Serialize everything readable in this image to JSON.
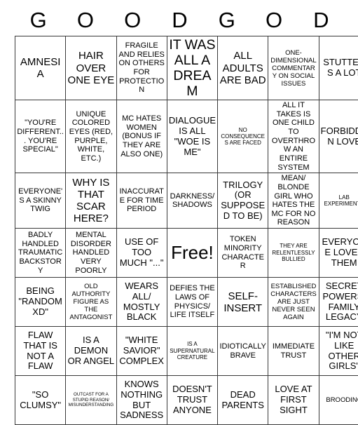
{
  "card": {
    "header_letters": [
      "G",
      "O",
      "O",
      "D",
      "G",
      "O",
      "D"
    ],
    "free_space_label": "Free!",
    "colors": {
      "border": "#3a3a3a",
      "background": "#ffffff",
      "text": "#000000"
    },
    "rows": [
      [
        {
          "text": "AMNESIA",
          "size": "xl"
        },
        {
          "text": "HAIR OVER ONE EYE",
          "size": "xl"
        },
        {
          "text": "FRAGILE AND RELIES ON OTHERS FOR PROTECTION",
          "size": "md"
        },
        {
          "text": "IT WAS ALL A DREAM",
          "size": "xxl"
        },
        {
          "text": "ALL ADULTS ARE BAD",
          "size": "xl"
        },
        {
          "text": "ONE-DIMENSIONAL COMMENTARY ON SOCIAL ISSUES",
          "size": "sm"
        },
        {
          "text": "STUTTERS A LOT",
          "size": "lg"
        }
      ],
      [
        {
          "text": "\"YOU'RE DIFFERENT... YOU'RE SPECIAL\"",
          "size": "md"
        },
        {
          "text": "UNIQUE COLORED EYES (RED, PURPLE, WHITE, ETC.)",
          "size": "md"
        },
        {
          "text": "MC HATES WOMEN (BONUS IF THEY ARE ALSO ONE)",
          "size": "md"
        },
        {
          "text": "DIALOGUE IS ALL \"WOE IS ME\"",
          "size": "lg"
        },
        {
          "text": "NO CONSEQUENCES ARE FACED",
          "size": "xs"
        },
        {
          "text": "ALL IT TAKES IS ONE CHILD TO OVERTHROW AN ENTIRE SYSTEM",
          "size": "md"
        },
        {
          "text": "FORBIDDEN LOVE",
          "size": "lg"
        }
      ],
      [
        {
          "text": "EVERYONE'S A SKINNY TWIG",
          "size": "md"
        },
        {
          "text": "WHY IS THAT SCAR HERE?",
          "size": "xl"
        },
        {
          "text": "INACCURATE FOR TIME PERIOD",
          "size": "md"
        },
        {
          "text": "DARKNESS/ SHADOWS",
          "size": "md"
        },
        {
          "text": "TRILOGY (OR SUPPOSED TO BE)",
          "size": "lg"
        },
        {
          "text": "MEAN/ BLONDE GIRL WHO HATES THE MC FOR NO REASON",
          "size": "md"
        },
        {
          "text": "LAB EXPERIMENTS",
          "size": "xs"
        }
      ],
      [
        {
          "text": "BADLY HANDLED TRAUMATIC BACKSTORY",
          "size": "md"
        },
        {
          "text": "MENTAL DISORDER HANDLED VERY POORLY",
          "size": "md"
        },
        {
          "text": "USE OF TOO MUCH \"...\"",
          "size": "lg"
        },
        {
          "text": "Free!",
          "size": "free"
        },
        {
          "text": "TOKEN MINORITY CHARACTER",
          "size": "md"
        },
        {
          "text": "THEY ARE RELENTLESSLY BULLIED",
          "size": "xs"
        },
        {
          "text": "EVERYONE LOVES THEM",
          "size": "lg"
        }
      ],
      [
        {
          "text": "BEING \"RANDOM XD\"",
          "size": "lg"
        },
        {
          "text": "OLD AUTHORITY FIGURE AS THE ANTAGONIST",
          "size": "sm"
        },
        {
          "text": "WEARS ALL/ MOSTLY BLACK",
          "size": "lg"
        },
        {
          "text": "DEFIES THE LAWS OF PHYSICS/ LIFE ITSELF",
          "size": "md"
        },
        {
          "text": "SELF-INSERT",
          "size": "xl"
        },
        {
          "text": "ESTABLISHED CHARACTERS ARE JUST NEVER SEEN AGAIN",
          "size": "sm"
        },
        {
          "text": "SECRET POWERS/ FAMILY LEGACY",
          "size": "lg"
        }
      ],
      [
        {
          "text": "FLAW THAT IS NOT A FLAW",
          "size": "lg"
        },
        {
          "text": "IS A DEMON OR ANGEL",
          "size": "lg"
        },
        {
          "text": "\"WHITE SAVIOR\" COMPLEX",
          "size": "lg"
        },
        {
          "text": "IS A SUPERNATURAL CREATURE",
          "size": "xs"
        },
        {
          "text": "IDIOTICALLY BRAVE",
          "size": "md"
        },
        {
          "text": "IMMEDIATE TRUST",
          "size": "md"
        },
        {
          "text": "\"I'M NOT LIKE OTHER GIRLS\"",
          "size": "lg"
        }
      ],
      [
        {
          "text": "\"SO CLUMSY\"",
          "size": "lg"
        },
        {
          "text": "OUTCAST FOR A STUPID REASON/ MISUNDERSTANDING",
          "size": "xxs"
        },
        {
          "text": "KNOWS NOTHING BUT SADNESS",
          "size": "lg"
        },
        {
          "text": "DOESN'T TRUST ANYONE",
          "size": "lg"
        },
        {
          "text": "DEAD PARENTS",
          "size": "lg"
        },
        {
          "text": "LOVE AT FIRST SIGHT",
          "size": "lg"
        },
        {
          "text": "BROODING",
          "size": "sm"
        }
      ]
    ]
  }
}
